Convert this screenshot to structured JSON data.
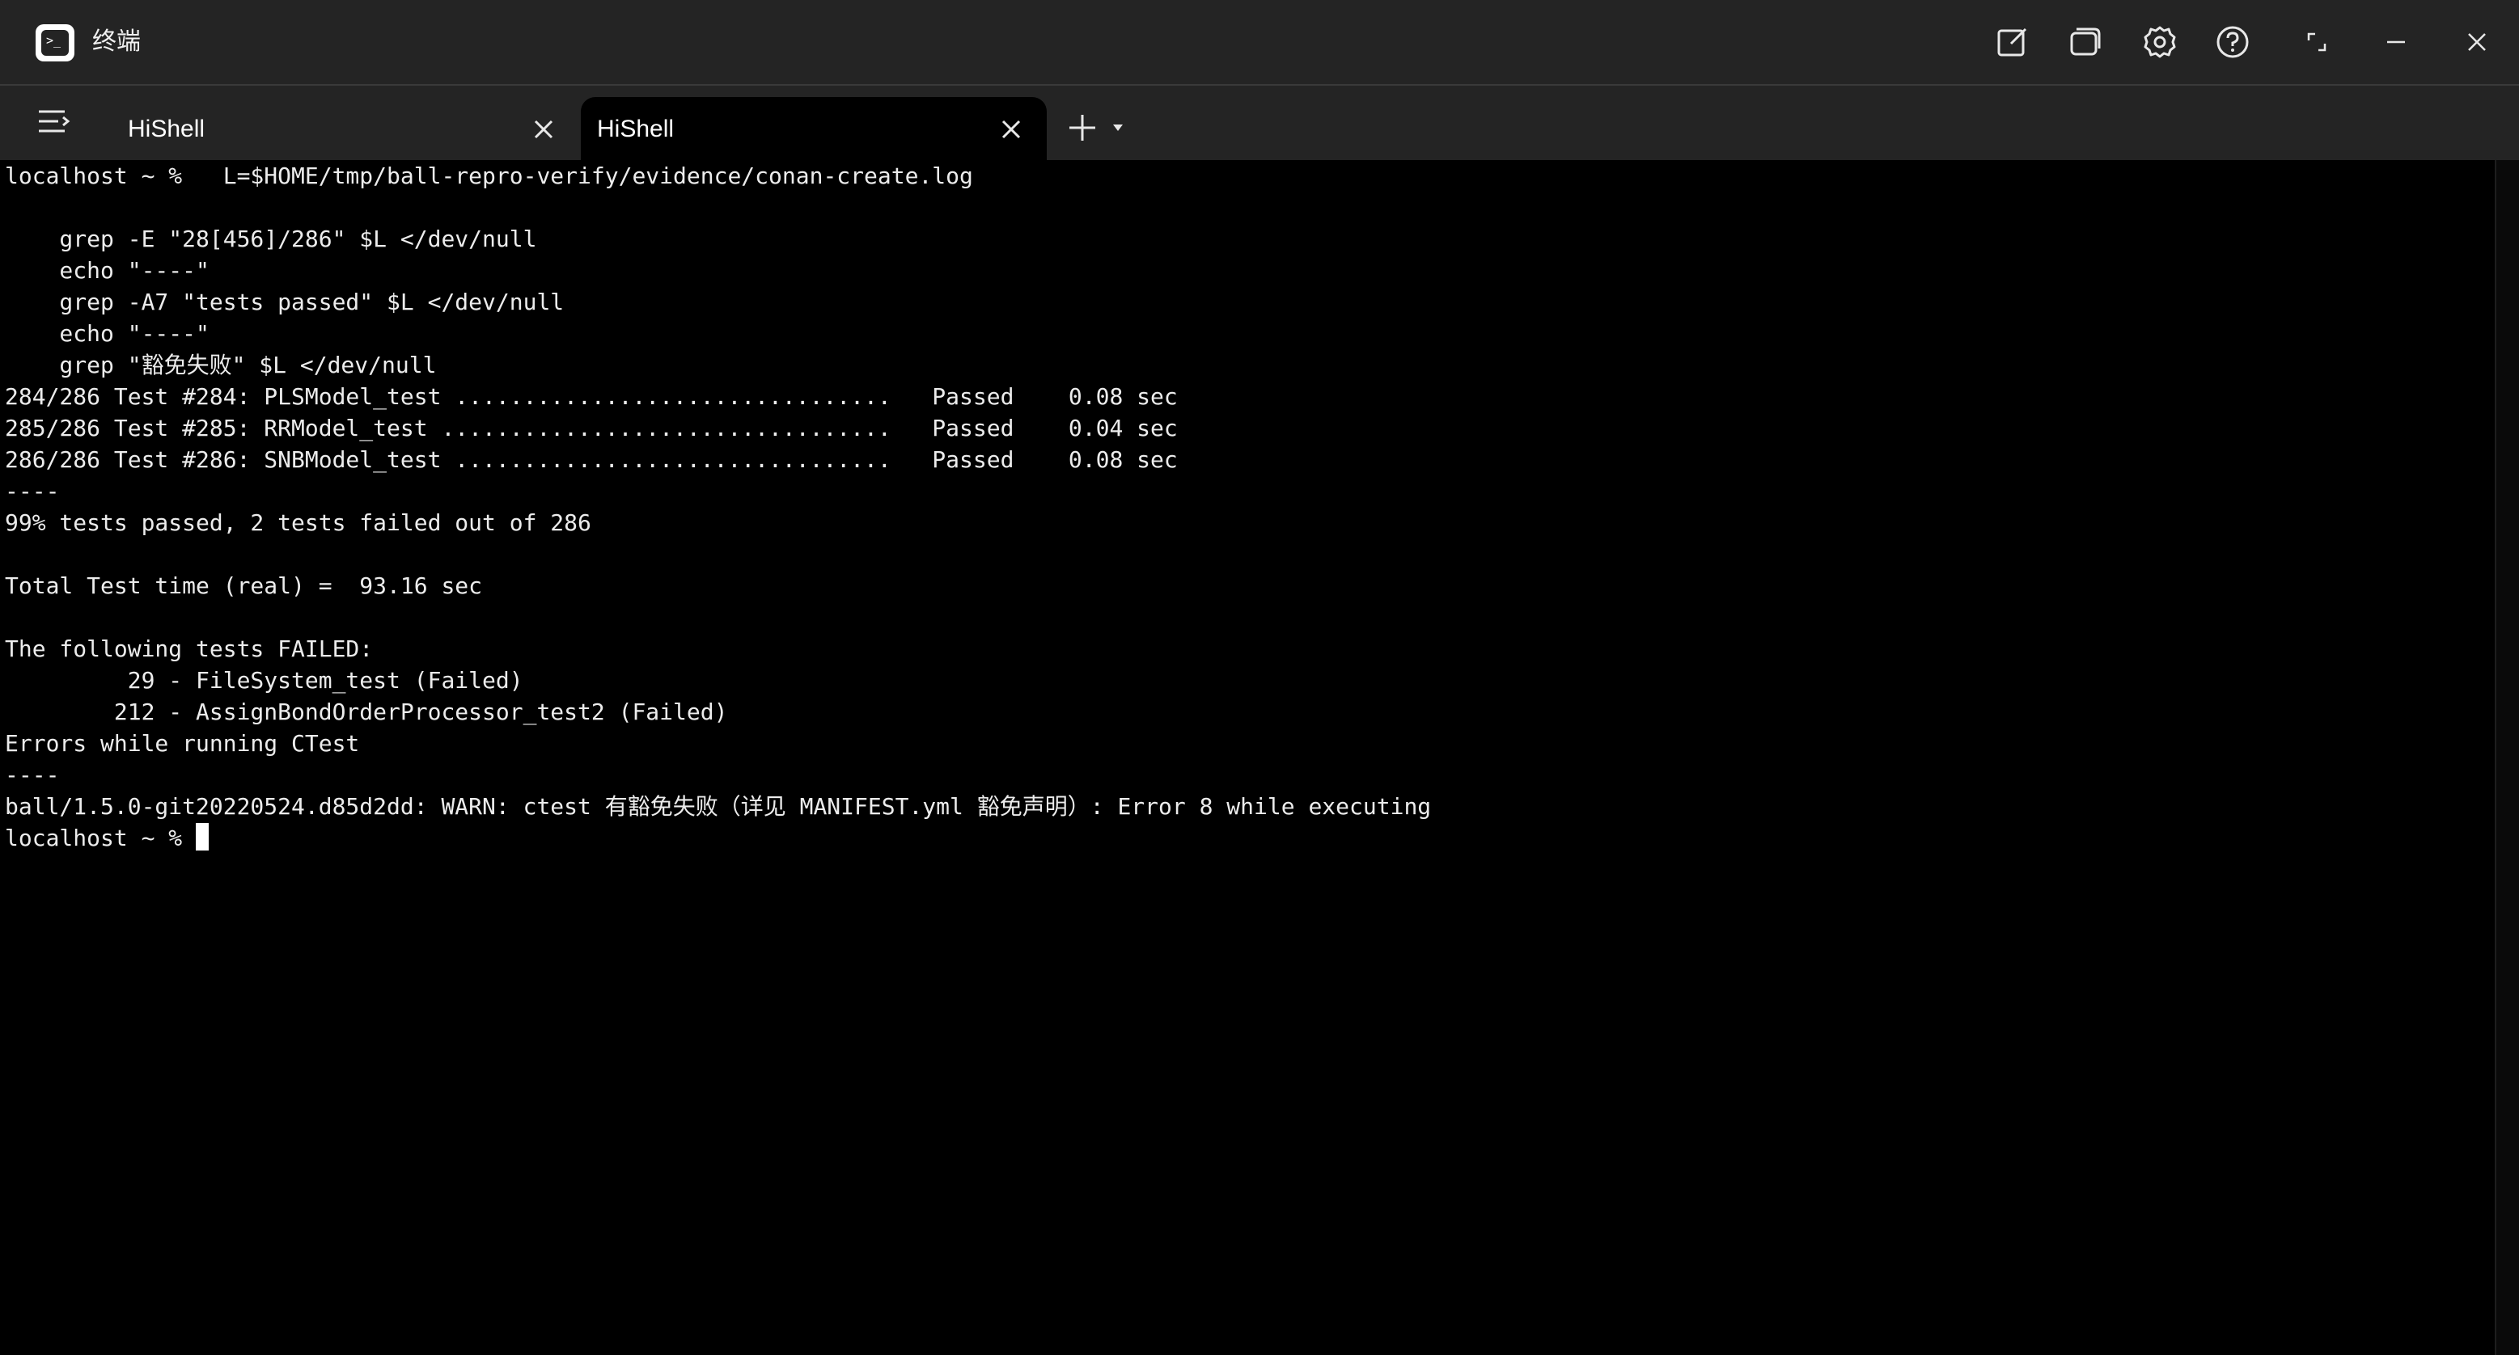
{
  "window": {
    "title": "终端",
    "app_icon_glyph": ">_"
  },
  "titlebar_buttons": [
    {
      "name": "edit-icon"
    },
    {
      "name": "split-window-icon"
    },
    {
      "name": "gear-icon"
    },
    {
      "name": "help-icon"
    },
    {
      "name": "restore-icon"
    },
    {
      "name": "minimize-icon"
    },
    {
      "name": "close-icon"
    }
  ],
  "tabs": [
    {
      "label": "HiShell",
      "active": false
    },
    {
      "label": "HiShell",
      "active": true
    }
  ],
  "terminal": {
    "lines": [
      "localhost ~ %   L=$HOME/tmp/ball-repro-verify/evidence/conan-create.log",
      "",
      "    grep -E \"28[456]/286\" $L </dev/null",
      "    echo \"----\"",
      "    grep -A7 \"tests passed\" $L </dev/null",
      "    echo \"----\"",
      "    grep \"豁免失败\" $L </dev/null",
      "284/286 Test #284: PLSModel_test ................................   Passed    0.08 sec",
      "285/286 Test #285: RRModel_test .................................   Passed    0.04 sec",
      "286/286 Test #286: SNBModel_test ................................   Passed    0.08 sec",
      "----",
      "99% tests passed, 2 tests failed out of 286",
      "",
      "Total Test time (real) =  93.16 sec",
      "",
      "The following tests FAILED:",
      "         29 - FileSystem_test (Failed)",
      "        212 - AssignBondOrderProcessor_test2 (Failed)",
      "Errors while running CTest",
      "----",
      "ball/1.5.0-git20220524.d85d2dd: WARN: ctest 有豁免失败（详见 MANIFEST.yml 豁免声明）: Error 8 while executing"
    ],
    "prompt": "localhost ~ % "
  },
  "colors": {
    "titlebar_bg": "#242424",
    "terminal_bg": "#000000",
    "text": "#ececec"
  }
}
